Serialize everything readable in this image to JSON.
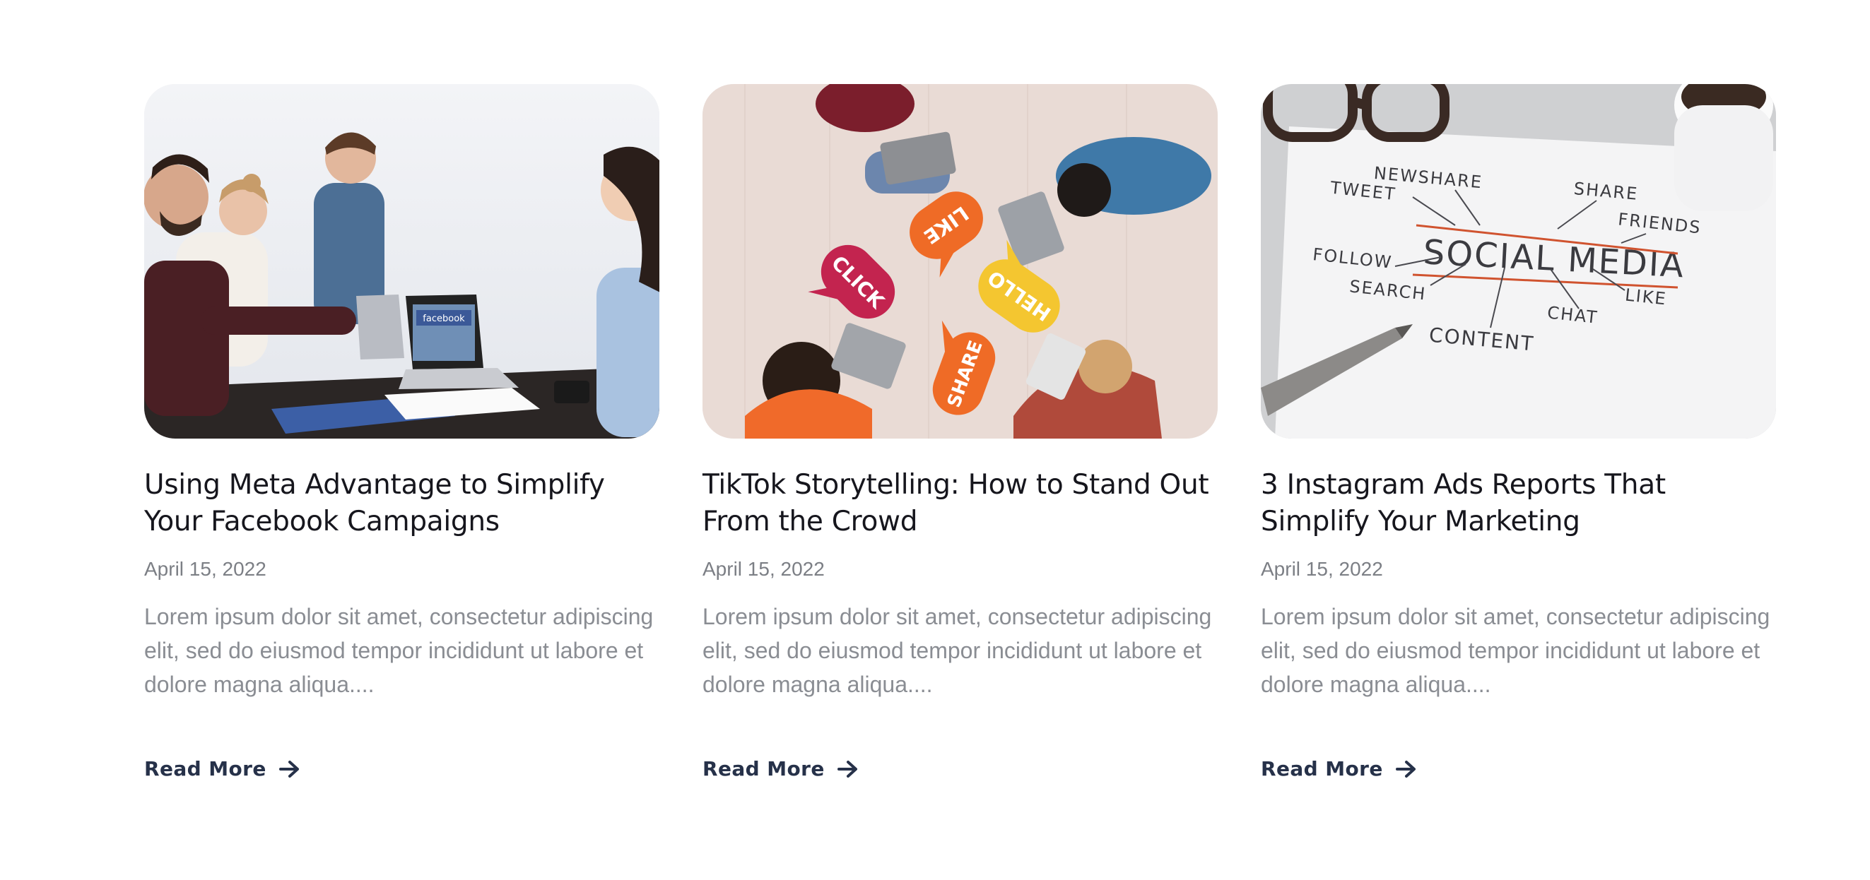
{
  "posts": [
    {
      "title": "Using Meta Advantage to Simplify Your Facebook Campaigns",
      "date": "April 15, 2022",
      "excerpt": "Lorem ipsum dolor sit amet, consectetur adipiscing elit, sed do eiusmod tempor incididunt ut labore et dolore magna aliqua....",
      "read_more": "Read More",
      "image_text": "facebook"
    },
    {
      "title": "TikTok Storytelling: How to Stand Out From the Crowd",
      "date": "April 15, 2022",
      "excerpt": "Lorem ipsum dolor sit amet, consectetur adipiscing elit, sed do eiusmod tempor incididunt ut labore et dolore magna aliqua....",
      "read_more": "Read More",
      "bubbles": [
        "LIKE",
        "CLICK",
        "HELLO",
        "SHARE"
      ]
    },
    {
      "title": "3 Instagram Ads Reports That Simplify Your Marketing",
      "date": "April 15, 2022",
      "excerpt": "Lorem ipsum dolor sit amet, consectetur adipiscing elit, sed do eiusmod tempor incididunt ut labore et dolore magna aliqua....",
      "read_more": "Read More",
      "sketch_words": {
        "main": "SOCIAL MEDIA",
        "newshare": "NEWSHARE",
        "tweet": "TWEET",
        "share": "SHARE",
        "friends": "FRIENDS",
        "follow": "FOLLOW",
        "search": "SEARCH",
        "chat": "CHAT",
        "like": "LIKE",
        "content": "CONTENT"
      }
    }
  ],
  "colors": {
    "title": "#16161d",
    "muted": "#8a8d93",
    "link": "#263149"
  }
}
